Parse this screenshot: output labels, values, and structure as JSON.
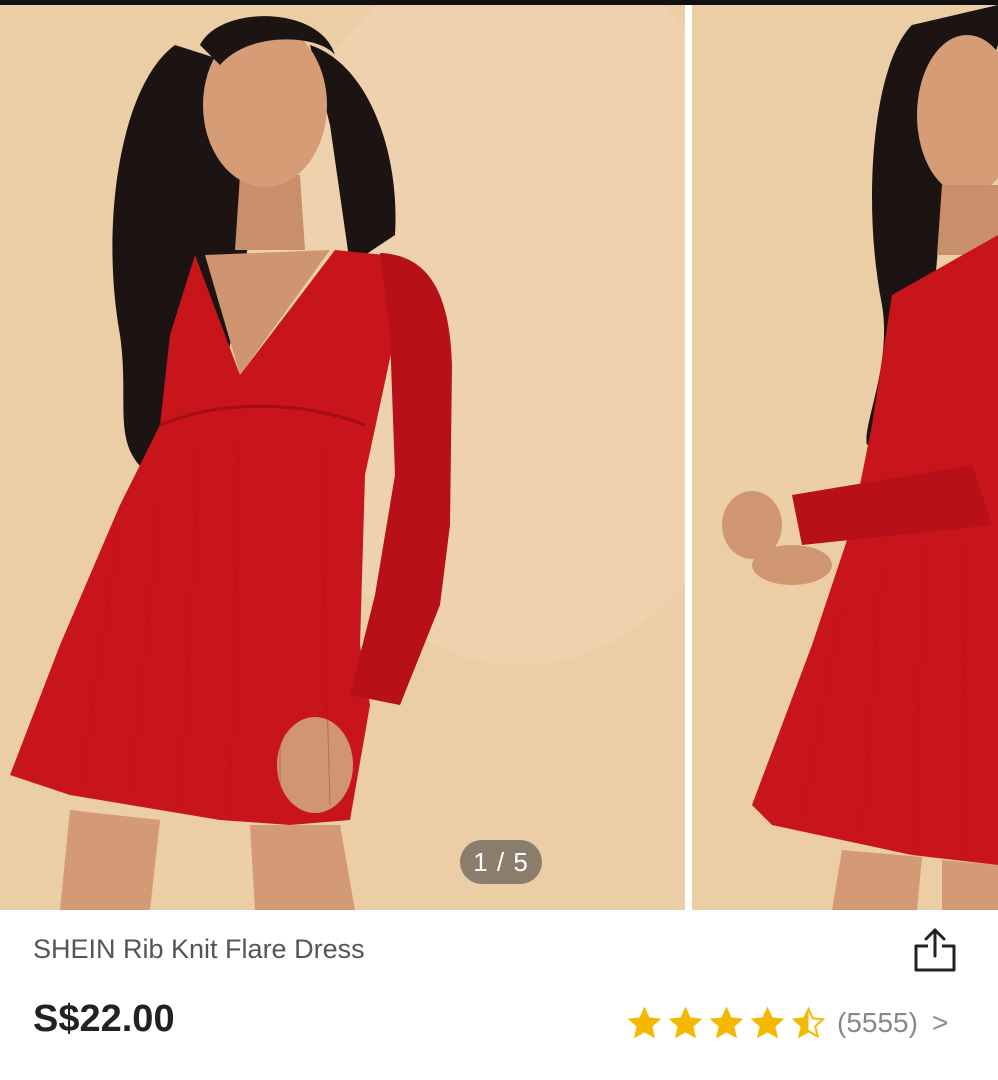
{
  "gallery": {
    "current_index": 1,
    "total": 5,
    "counter_text": "1 / 5",
    "slides": [
      {
        "subject": "model-front-red-dress",
        "dress_color": "#c8141b",
        "background_color": "#ebcda6"
      },
      {
        "subject": "model-side-red-dress",
        "dress_color": "#c8141b",
        "background_color": "#ebcda6"
      }
    ]
  },
  "product": {
    "title": "SHEIN Rib Knit Flare Dress",
    "price": "S$22.00",
    "rating": 4.5,
    "rating_max": 5,
    "review_count_text": "(5555)"
  },
  "icons": {
    "share": "share-icon",
    "star": "star-icon",
    "chevron": "chevron-right-icon"
  },
  "colors": {
    "star": "#f5b800",
    "price": "#222222",
    "title": "#555555",
    "muted": "#888888"
  }
}
